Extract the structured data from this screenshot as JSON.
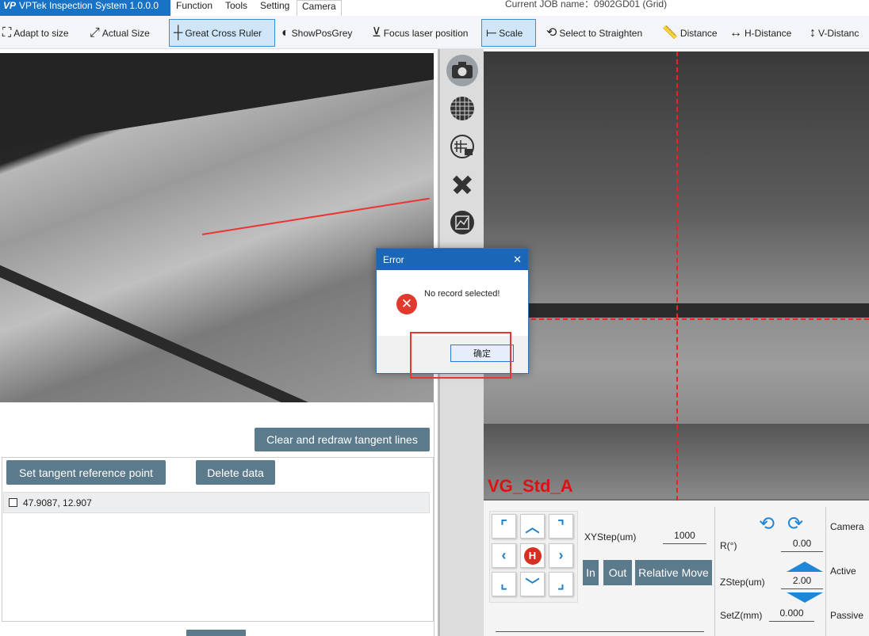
{
  "app": {
    "title": "VPTek Inspection System 1.0.0.0",
    "logo": "VP"
  },
  "menu": [
    "Function",
    "Tools",
    "Setting",
    "Camera"
  ],
  "job": {
    "label": "Current JOB name：0902GD01 (Grid)"
  },
  "toolbar": {
    "adapt": "Adapt to size",
    "actual": "Actual Size",
    "cross": "Great Cross Ruler",
    "grey": "ShowPosGrey",
    "focus": "Focus laser position",
    "scale": "Scale",
    "straighten": "Select to Straighten",
    "distance": "Distance",
    "hdist": "H-Distance",
    "vdist": "V-Distanc"
  },
  "left": {
    "clear_btn": "Clear and redraw tangent lines",
    "set_btn": "Set tangent reference point",
    "delete_btn": "Delete data",
    "rows": [
      "47.9087, 12.907"
    ]
  },
  "right": {
    "overlay": "VG_Std_A",
    "xystep_label": "XYStep(um)",
    "xystep": "1000",
    "r_label": "R(°)",
    "r_val": "0.00",
    "zstep_label": "ZStep(um)",
    "zstep": "2.00",
    "setz_label": "SetZ(mm)",
    "setz": "0.000",
    "in": "In",
    "out": "Out",
    "relmove": "Relative Move",
    "camera": "Camera",
    "active": "Active",
    "passive": "Passive",
    "home": "H"
  },
  "dialog": {
    "title": "Error",
    "message": "No record selected!",
    "ok": "确定",
    "close": "✕"
  },
  "colors": {
    "brand": "#1872c5",
    "dialog_title": "#1c66b8",
    "accent_red": "#e33333",
    "slate_btn": "#5b7a8c"
  }
}
